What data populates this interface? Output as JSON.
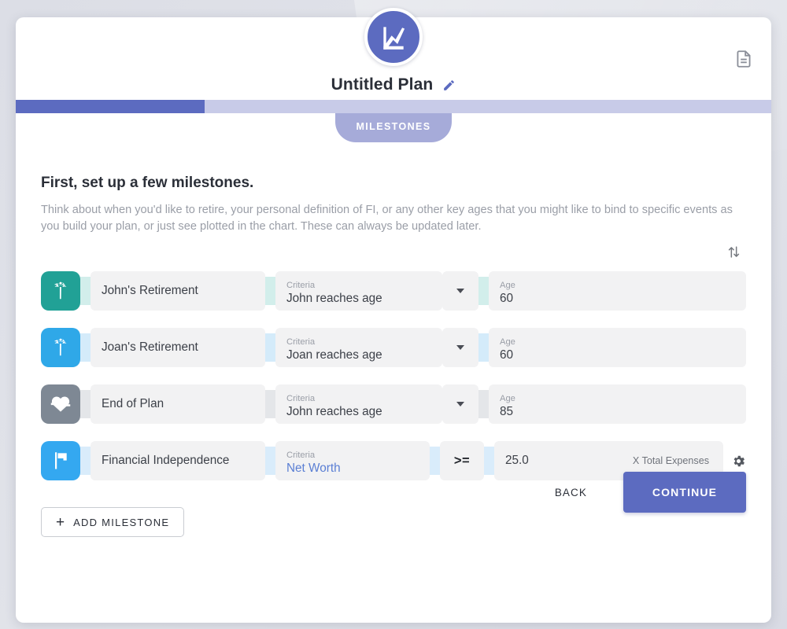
{
  "brand": {
    "logo_icon": "chart-zigzag-icon",
    "logo_color": "#5c6bc0"
  },
  "header": {
    "plan_title": "Untitled Plan",
    "edit_icon": "pencil-icon",
    "document_icon": "document-icon",
    "progress_percent": 25,
    "stage_label": "MILESTONES"
  },
  "main": {
    "heading": "First, set up a few milestones.",
    "description": "Think about when you'd like to retire, your personal definition of FI, or any other key ages that you might like to bind to specific events as you build your plan, or just see plotted in the chart. These can always be updated later.",
    "sort_icon": "sort-arrows-icon"
  },
  "milestones": [
    {
      "icon": "palm-tree-icon",
      "icon_color": "#21a196",
      "link_color": "#d2eeeb",
      "name": "John's Retirement",
      "criteria_label": "Criteria",
      "criteria_value": "John reaches age",
      "has_caret": true,
      "value_label": "Age",
      "value": "60"
    },
    {
      "icon": "palm-tree-icon",
      "icon_color": "#2fa8e8",
      "link_color": "#d4ebfa",
      "name": "Joan's Retirement",
      "criteria_label": "Criteria",
      "criteria_value": "Joan reaches age",
      "has_caret": true,
      "value_label": "Age",
      "value": "60"
    },
    {
      "icon": "heart-pulse-icon",
      "icon_color": "#7e8894",
      "link_color": "#e4e6e9",
      "name": "End of Plan",
      "criteria_label": "Criteria",
      "criteria_value": "John reaches age",
      "has_caret": true,
      "value_label": "Age",
      "value": "85"
    },
    {
      "icon": "flag-icon",
      "icon_color": "#34a8f0",
      "link_color": "#d9ecfb",
      "name": "Financial Independence",
      "criteria_label": "Criteria",
      "criteria_value": "Net Worth",
      "has_caret": false,
      "operator": ">=",
      "amount": "25.0",
      "amount_suffix": "X Total Expenses",
      "settings_icon": "gear-icon"
    }
  ],
  "actions": {
    "add_milestone": "ADD MILESTONE",
    "add_icon": "plus-icon",
    "back": "BACK",
    "continue": "CONTINUE"
  }
}
